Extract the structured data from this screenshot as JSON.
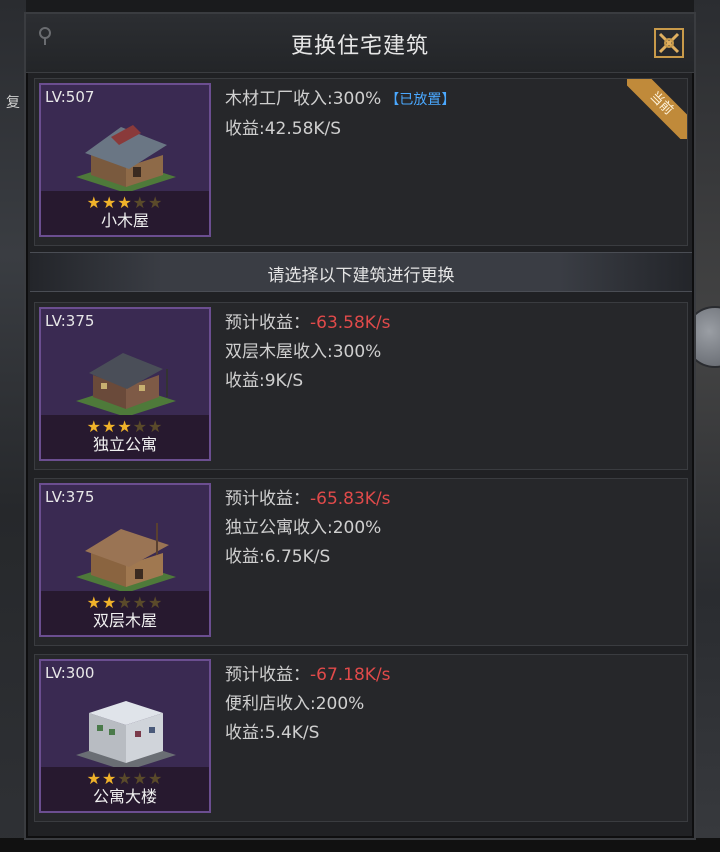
{
  "header": {
    "title": "更换住宅建筑"
  },
  "side": {
    "left_tag": "复"
  },
  "current": {
    "level": "LV:507",
    "name": "小木屋",
    "stars": 3,
    "bonus": "木材工厂收入:300%",
    "placed_badge": "【已放置】",
    "income": "收益:42.58K/S",
    "ribbon": "当前"
  },
  "divider": {
    "text": "请选择以下建筑进行更换"
  },
  "options": [
    {
      "level": "LV:375",
      "name": "独立公寓",
      "stars": 3,
      "expected_label": "预计收益：",
      "expected_value": "-63.58K/s",
      "bonus": "双层木屋收入:300%",
      "income": "收益:9K/S"
    },
    {
      "level": "LV:375",
      "name": "双层木屋",
      "stars": 2,
      "expected_label": "预计收益：",
      "expected_value": "-65.83K/s",
      "bonus": "独立公寓收入:200%",
      "income": "收益:6.75K/S"
    },
    {
      "level": "LV:300",
      "name": "公寓大楼",
      "stars": 2,
      "expected_label": "预计收益：",
      "expected_value": "-67.18K/s",
      "bonus": "便利店收入:200%",
      "income": "收益:5.4K/S"
    }
  ],
  "colors": {
    "negative": "#e04a4a",
    "placed": "#4aa8ff",
    "star": "#f0b22a",
    "thumb_bg": "#3a2a52"
  }
}
